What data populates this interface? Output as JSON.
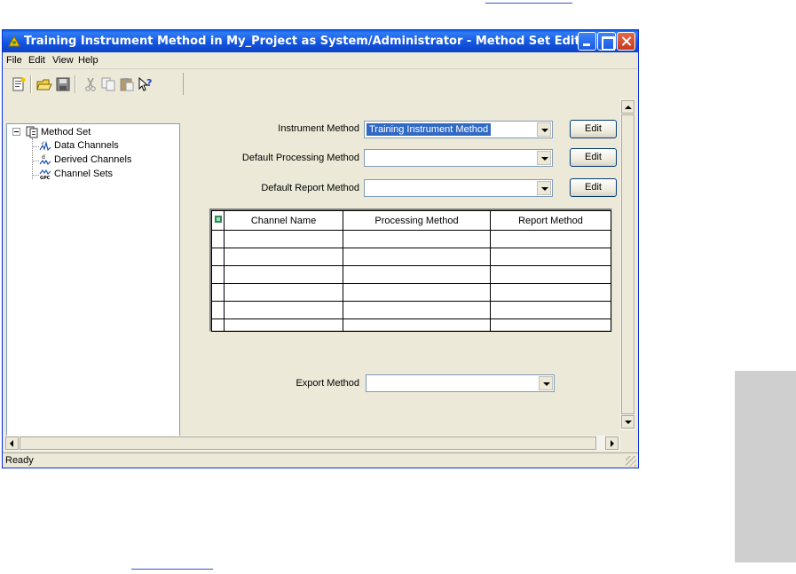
{
  "window": {
    "title": "Training Instrument Method in My_Project as System/Administrator - Method Set Editor"
  },
  "menu": [
    "File",
    "Edit",
    "View",
    "Help"
  ],
  "toolbar_icons": [
    "new-icon",
    "open-folder-icon",
    "save-icon",
    "cut-icon",
    "copy-icon",
    "paste-icon",
    "whats-this-help-icon"
  ],
  "tree": {
    "root": "Method Set",
    "children": [
      "Data Channels",
      "Derived Channels",
      "Channel Sets"
    ]
  },
  "form": {
    "instrument_method_label": "Instrument Method",
    "instrument_method_value": "Training Instrument Method",
    "processing_method_label": "Default Processing Method",
    "processing_method_value": "",
    "report_method_label": "Default Report Method",
    "report_method_value": "",
    "export_method_label": "Export Method",
    "export_method_value": "",
    "edit_label": "Edit"
  },
  "grid": {
    "columns": [
      "Channel Name",
      "Processing Method",
      "Report Method"
    ],
    "rows": [
      [
        "",
        "",
        ""
      ],
      [
        "",
        "",
        ""
      ],
      [
        "",
        "",
        ""
      ],
      [
        "",
        "",
        ""
      ],
      [
        "",
        "",
        ""
      ],
      [
        "",
        "",
        ""
      ]
    ]
  },
  "status": "Ready",
  "colors": {
    "titlebar": "#0a5de8",
    "selection": "#316ac5",
    "face": "#ece9d8"
  }
}
